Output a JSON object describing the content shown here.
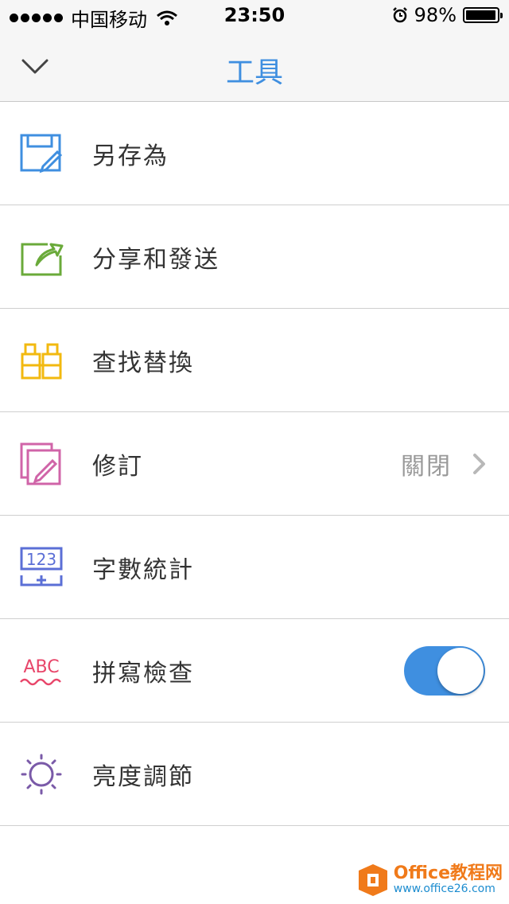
{
  "status_bar": {
    "carrier": "中国移动",
    "time": "23:50",
    "battery_percent": "98%",
    "battery_level": 0.98
  },
  "nav": {
    "title": "工具",
    "back_icon": "chevron-down-icon"
  },
  "items": [
    {
      "label": "另存為",
      "icon": "save-as-icon",
      "color": "#3f8fe0"
    },
    {
      "label": "分享和發送",
      "icon": "share-send-icon",
      "color": "#6aaa3a"
    },
    {
      "label": "查找替換",
      "icon": "binoculars-icon",
      "color": "#f2b90f"
    },
    {
      "label": "修訂",
      "icon": "track-changes-icon",
      "color": "#d064a8",
      "value": "關閉"
    },
    {
      "label": "字數統計",
      "icon": "word-count-icon",
      "color": "#5b6fd6",
      "icon_text": "123"
    },
    {
      "label": "拼寫檢查",
      "icon": "spell-check-icon",
      "color": "#e8466a",
      "icon_text": "ABC",
      "toggle_on": true
    },
    {
      "label": "亮度調節",
      "icon": "brightness-icon",
      "color": "#7a5aa8"
    }
  ],
  "watermark": {
    "name": "Office教程网",
    "url": "www.office26.com",
    "logo_color": "#f07a1a"
  }
}
